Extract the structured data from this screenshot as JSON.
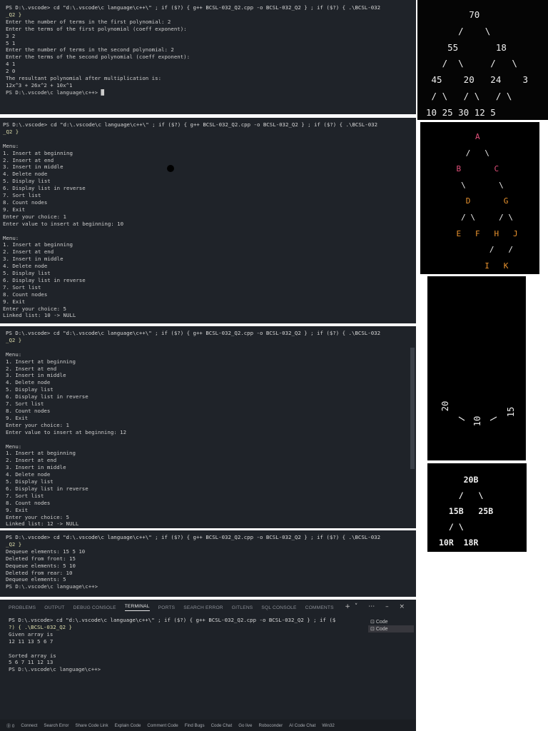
{
  "terminal1": {
    "lines": [
      "PS D:\\.vscode> cd \"d:\\.vscode\\c language\\c++\\\" ; if ($?) { g++ BCSL-032_Q2.cpp -o BCSL-032_Q2 } ; if ($?) { .\\BCSL-032",
      "_Q2 }",
      "Enter the number of terms in the first polynomial: 2",
      "Enter the terms of the first polynomial (coeff exponent):",
      "3 2",
      "5 1",
      "Enter the number of terms in the second polynomial: 2",
      "Enter the terms of the second polynomial (coeff exponent):",
      "4 1",
      "2 0",
      "The resultant polynomial after multiplication is:",
      "12x^3 + 26x^2 + 10x^1",
      "PS D:\\.vscode\\c language\\c++> █"
    ]
  },
  "terminal2": {
    "lines": [
      "PS D:\\.vscode> cd \"d:\\.vscode\\c language\\c++\\\" ; if ($?) { g++ BCSL-032_Q2.cpp -o BCSL-032_Q2 } ; if ($?) { .\\BCSL-032",
      "_Q2 }",
      "",
      "Menu:",
      "1. Insert at beginning",
      "2. Insert at end",
      "3. Insert in middle",
      "4. Delete node",
      "5. Display list",
      "6. Display list in reverse",
      "7. Sort list",
      "8. Count nodes",
      "9. Exit",
      "Enter your choice: 1",
      "Enter value to insert at beginning: 10",
      "",
      "Menu:",
      "1. Insert at beginning",
      "2. Insert at end",
      "3. Insert in middle",
      "4. Delete node",
      "5. Display list",
      "6. Display list in reverse",
      "7. Sort list",
      "8. Count nodes",
      "9. Exit",
      "Enter your choice: 5",
      "Linked list: 10 -> NULL"
    ]
  },
  "terminal3": {
    "lines": [
      "PS D:\\.vscode> cd \"d:\\.vscode\\c language\\c++\\\" ; if ($?) { g++ BCSL-032_Q2.cpp -o BCSL-032_Q2 } ; if ($?) { .\\BCSL-032",
      "_Q2 }",
      "",
      "Menu:",
      "1. Insert at beginning",
      "2. Insert at end",
      "3. Insert in middle",
      "4. Delete node",
      "5. Display list",
      "6. Display list in reverse",
      "7. Sort list",
      "8. Count nodes",
      "9. Exit",
      "Enter your choice: 1",
      "Enter value to insert at beginning: 12",
      "",
      "Menu:",
      "1. Insert at beginning",
      "2. Insert at end",
      "3. Insert in middle",
      "4. Delete node",
      "5. Display list",
      "6. Display list in reverse",
      "7. Sort list",
      "8. Count nodes",
      "9. Exit",
      "Enter your choice: 5",
      "Linked list: 12 -> NULL"
    ]
  },
  "terminal4": {
    "lines": [
      "PS D:\\.vscode> cd \"d:\\.vscode\\c language\\c++\\\" ; if ($?) { g++ BCSL-032_Q2.cpp -o BCSL-032_Q2 } ; if ($?) { .\\BCSL-032",
      "_Q2 }",
      "Dequeue elements: 15 5 10",
      "Deleted from front: 15",
      "Dequeue elements: 5 10",
      "Deleted from rear: 10",
      "Dequeue elements: 5",
      "PS D:\\.vscode\\c language\\c++>"
    ]
  },
  "panel": {
    "tabs": [
      "PROBLEMS",
      "OUTPUT",
      "DEBUG CONSOLE",
      "TERMINAL",
      "PORTS",
      "SEARCH ERROR",
      "GITLENS",
      "SQL CONSOLE",
      "COMMENTS"
    ],
    "active_tab": "TERMINAL",
    "actions": "+˅ ⋯ – ×",
    "side_items": [
      "Code",
      "Code"
    ],
    "lines": [
      "PS D:\\.vscode> cd \"d:\\.vscode\\c language\\c++\\\" ; if ($?) { g++ BCSL-032_Q2.cpp -o BCSL-032_Q2 } ; if ($",
      "?) { .\\BCSL-032_Q2 }",
      "Given array is",
      "12 11 13 5 6 7",
      "",
      "Sorted array is",
      "5 6 7 11 12 13",
      "PS D:\\.vscode\\c language\\c++>"
    ]
  },
  "statusbar": {
    "items": [
      "⓪ 0",
      "Connect",
      "Search Error",
      "Share Code Link",
      "Explain Code",
      "Comment Code",
      "Find Bugs",
      "Code Chat",
      "Go live",
      "Roboconder",
      "AI Code Chat",
      "Win32"
    ]
  },
  "tree1": {
    "lines": [
      "        70",
      "      /    \\",
      "    55       18",
      "   /  \\     /   \\",
      " 45    20   24    3",
      " / \\   / \\   / \\",
      "10 25 30 12 5"
    ]
  },
  "tree2": {
    "lines": [
      "        A",
      "      /   \\",
      "    B       C",
      "     \\       \\",
      "      D       G",
      "     / \\     / \\",
      "    E   F   H   J",
      "           /   /",
      "          I   K"
    ]
  },
  "tree3": {
    "left": "20",
    "mid": "10",
    "right": "15"
  },
  "tree4": {
    "lines": [
      "     20B",
      "    /   \\",
      "  15B   25B",
      "  / \\",
      "10R  18R"
    ]
  },
  "colors": {
    "terminal_bg": "#1f2329",
    "cmd_yellow": "#dcdcaa",
    "string_blue": "#9cdcfe",
    "tree2_pink": "#e0507a",
    "tree2_orange": "#e8922e"
  }
}
